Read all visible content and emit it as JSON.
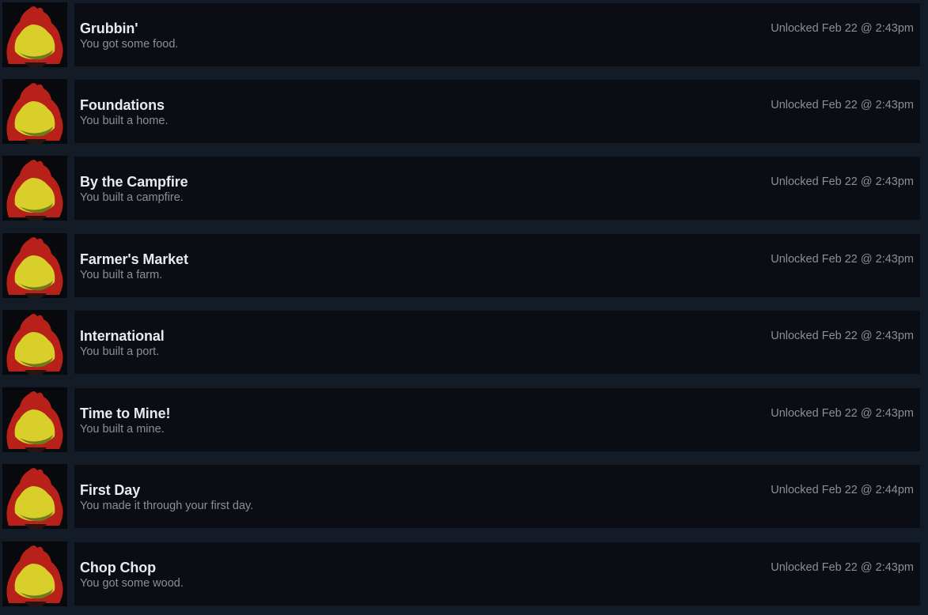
{
  "achievements": [
    {
      "title": "Grubbin'",
      "description": "You got some food.",
      "unlocked": "Unlocked Feb 22 @ 2:43pm",
      "icon": "campfire-icon"
    },
    {
      "title": "Foundations",
      "description": "You built a home.",
      "unlocked": "Unlocked Feb 22 @ 2:43pm",
      "icon": "campfire-icon"
    },
    {
      "title": "By the Campfire",
      "description": "You built a campfire.",
      "unlocked": "Unlocked Feb 22 @ 2:43pm",
      "icon": "campfire-icon"
    },
    {
      "title": "Farmer's Market",
      "description": "You built a farm.",
      "unlocked": "Unlocked Feb 22 @ 2:43pm",
      "icon": "campfire-icon"
    },
    {
      "title": "International",
      "description": "You built a port.",
      "unlocked": "Unlocked Feb 22 @ 2:43pm",
      "icon": "campfire-icon"
    },
    {
      "title": "Time to Mine!",
      "description": "You built a mine.",
      "unlocked": "Unlocked Feb 22 @ 2:43pm",
      "icon": "campfire-icon"
    },
    {
      "title": "First Day",
      "description": "You made it through your first day.",
      "unlocked": "Unlocked Feb 22 @ 2:44pm",
      "icon": "campfire-icon"
    },
    {
      "title": "Chop Chop",
      "description": "You got some wood.",
      "unlocked": "Unlocked Feb 22 @ 2:43pm",
      "icon": "campfire-icon"
    }
  ],
  "colors": {
    "page_background": "#131c26",
    "row_background": "#0a0e14",
    "title_text": "#e8eaed",
    "secondary_text": "#8a8f96",
    "flame_red": "#c0231a",
    "flame_yellow": "#c9c22a"
  }
}
